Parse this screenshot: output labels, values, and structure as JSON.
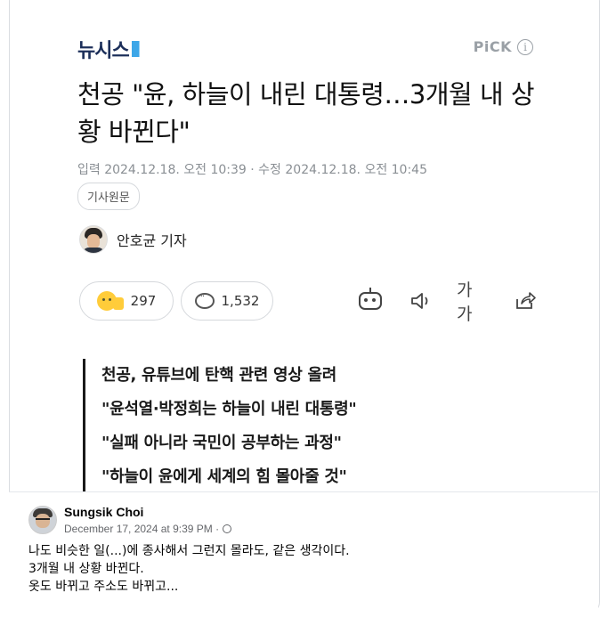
{
  "article": {
    "logo": "뉴시스",
    "pick_label": "PiCK",
    "info_icon": "i",
    "headline": "천공 \"윤, 하늘이 내린 대통령…3개월 내 상황 바뀐다\"",
    "meta": "입력 2024.12.18. 오전 10:39 · 수정 2024.12.18. 오전 10:45",
    "original_button": "기사원문",
    "reporter": "안호균 기자",
    "like_count": "297",
    "comment_count": "1,532",
    "font_tool_label": "가가",
    "subheadings": [
      "천공, 유튜브에 탄핵 관련 영상 올려",
      "\"윤석열·박정희는 하늘이 내린 대통령\"",
      "\"실패 아니라 국민이 공부하는 과정\"",
      "\"하늘이 윤에게 세계의 힘 몰아줄 것\""
    ]
  },
  "post": {
    "author": "Sungsik Choi",
    "timestamp": "December 17, 2024 at 9:39 PM ·",
    "lines": [
      "나도 비슷한 일(...)에 종사해서 그런지 몰라도, 같은 생각이다.",
      "3개월 내 상황 바뀐다.",
      "옷도 바뀌고 주소도 바뀌고..."
    ]
  }
}
